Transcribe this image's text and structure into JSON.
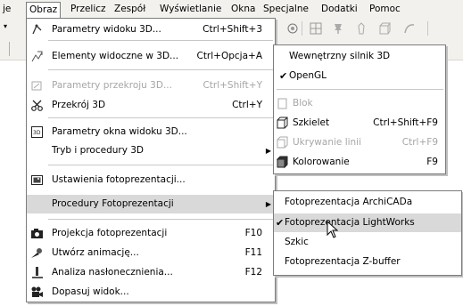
{
  "menubar": {
    "items": [
      "je",
      "Obraz",
      "Przelicz",
      "Zespół",
      "Wyświetlanie",
      "Okna",
      "Specjalne",
      "Dodatki",
      "Pomoc"
    ]
  },
  "main_menu": {
    "items": [
      {
        "label": "Parametry widoku 3D...",
        "shortcut": "Ctrl+Shift+3",
        "icon": "3d-view-params-icon"
      },
      {
        "label": "Elementy widoczne w 3D...",
        "shortcut": "Ctrl+Opcja+A",
        "icon": "visible-elements-icon"
      },
      {
        "label": "Parametry przekroju 3D...",
        "shortcut": "Ctrl+Shift+Y",
        "icon": "section-params-icon",
        "disabled": true
      },
      {
        "label": "Przekrój 3D",
        "shortcut": "Ctrl+Y",
        "icon": "scissors-icon"
      },
      {
        "label": "Parametry okna widoku 3D...",
        "shortcut": "",
        "icon": "3d-window-icon"
      },
      {
        "label": "Tryb i procedury 3D",
        "shortcut": "",
        "icon": "",
        "submenu": true
      },
      {
        "label": "Ustawienia fotoprezentacji...",
        "shortcut": "",
        "icon": "photo-settings-icon"
      },
      {
        "label": "Procedury Fotoprezentacji",
        "shortcut": "",
        "icon": "",
        "submenu": true,
        "highlighted": true
      },
      {
        "label": "Projekcja fotoprezentacji",
        "shortcut": "F10",
        "icon": "camera-icon"
      },
      {
        "label": "Utwórz animację...",
        "shortcut": "F11",
        "icon": "animation-icon"
      },
      {
        "label": "Analiza nasłonecznienia...",
        "shortcut": "F12",
        "icon": "sun-study-icon"
      },
      {
        "label": "Dopasuj widok...",
        "shortcut": "",
        "icon": "movie-camera-icon"
      }
    ]
  },
  "engine_submenu": {
    "items": [
      {
        "label": "Wewnętrzny silnik 3D",
        "checked": false
      },
      {
        "label": "OpenGL",
        "checked": true
      },
      {
        "label": "Blok",
        "shortcut": "",
        "disabled": true
      },
      {
        "label": "Szkielet",
        "shortcut": "Ctrl+Shift+F9"
      },
      {
        "label": "Ukrywanie linii",
        "shortcut": "Ctrl+F9",
        "disabled": true
      },
      {
        "label": "Kolorowanie",
        "shortcut": "F9"
      }
    ]
  },
  "photo_submenu": {
    "items": [
      {
        "label": "Fotoprezentacja ArchiCADa",
        "checked": false
      },
      {
        "label": "Fotoprezentacja LightWorks",
        "checked": true,
        "highlighted": true
      },
      {
        "label": "Szkic",
        "checked": false
      },
      {
        "label": "Fotoprezentacja Z-buffer",
        "checked": false
      }
    ]
  }
}
